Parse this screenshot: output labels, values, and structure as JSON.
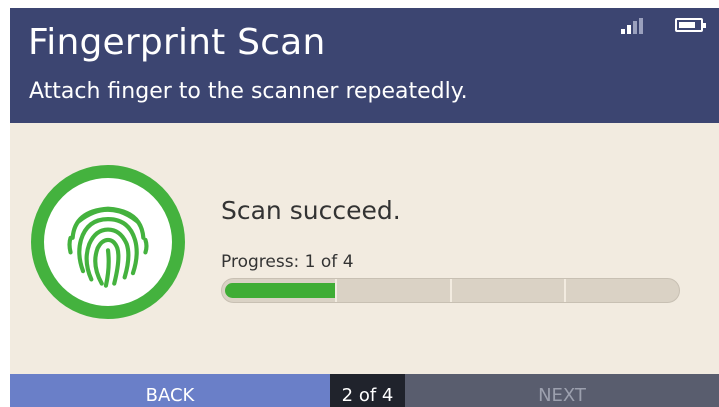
{
  "header": {
    "title": "Fingerprint Scan",
    "subtitle": "Attach finger to the scanner repeatedly."
  },
  "status_bar": {
    "signal_icon": "signal-strength-icon",
    "signal_level": 0.5,
    "battery_icon": "battery-icon",
    "battery_level": 0.8
  },
  "scan": {
    "icon": "fingerprint-icon",
    "status_text": "Scan succeed.",
    "progress_label": "Progress: 1 of 4",
    "progress_step": 1,
    "progress_total": 4
  },
  "footer": {
    "back_label": "BACK",
    "page_indicator": "2 of 4",
    "next_label": "NEXT"
  },
  "colors": {
    "header_bg": "#3c4571",
    "body_bg": "#f2ebe0",
    "accent_green": "#44b23e",
    "back_button_bg": "#6a7fc8",
    "next_button_bg": "#595d6e",
    "page_indicator_bg": "#20232c"
  }
}
